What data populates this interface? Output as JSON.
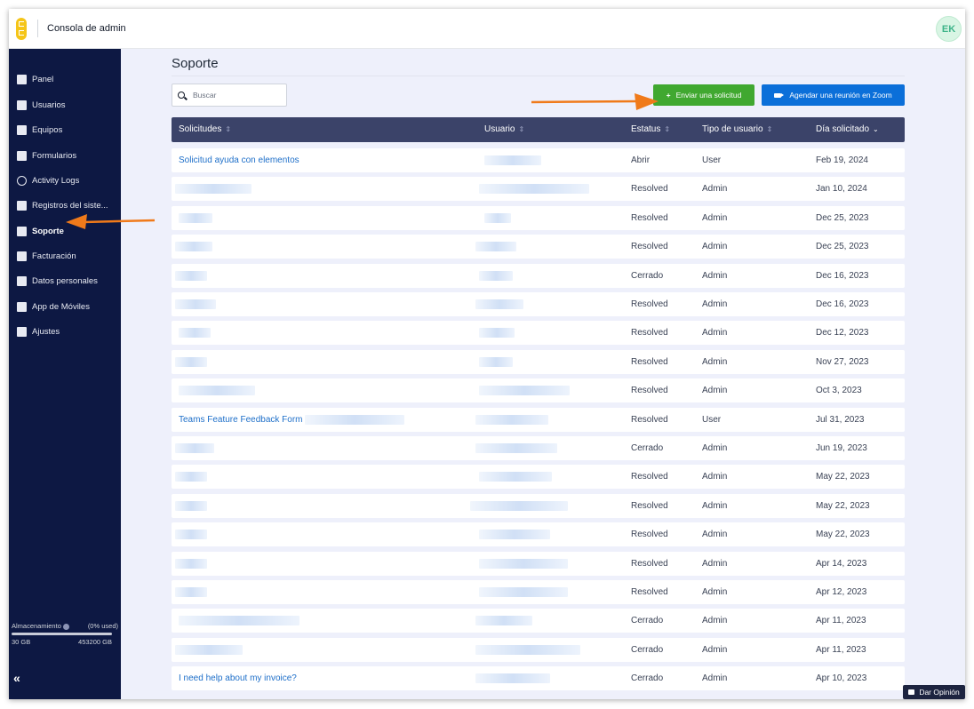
{
  "app": {
    "title": "Consola de admin",
    "avatar_initials": "EK"
  },
  "sidebar": {
    "items": [
      {
        "label": "Panel",
        "icon": "home-icon"
      },
      {
        "label": "Usuarios",
        "icon": "users-icon"
      },
      {
        "label": "Equipos",
        "icon": "teams-icon"
      },
      {
        "label": "Formularios",
        "icon": "forms-icon"
      },
      {
        "label": "Activity Logs",
        "icon": "clock-icon"
      },
      {
        "label": "Registros del siste...",
        "icon": "database-icon"
      },
      {
        "label": "Soporte",
        "icon": "support-icon"
      },
      {
        "label": "Facturación",
        "icon": "credit-card-icon"
      },
      {
        "label": "Datos personales",
        "icon": "personal-data-icon"
      },
      {
        "label": "App de Móviles",
        "icon": "mobile-icon"
      },
      {
        "label": "Ajustes",
        "icon": "gear-icon"
      }
    ],
    "active": "Soporte",
    "storage": {
      "label": "Almacenamiento",
      "used_text": "(0% used)",
      "used": "30 GB",
      "total": "453200 GB",
      "used_fraction": 0.0
    },
    "collapse_label": "«"
  },
  "main": {
    "title": "Soporte",
    "search": {
      "placeholder": "Buscar",
      "value": ""
    },
    "buttons": {
      "submit": "Enviar una solicitud",
      "zoom": "Agendar una reunión en Zoom"
    },
    "table": {
      "headers": [
        "Solicitudes",
        "Usuario",
        "Estatus",
        "Tipo de usuario",
        "Día solicitado"
      ],
      "rows": [
        {
          "request": "Solicitud ayuda con elementos",
          "status": "Abrir",
          "type": "User",
          "date": "Feb 19, 2024"
        },
        {
          "request": "",
          "status": "Resolved",
          "type": "Admin",
          "date": "Jan 10, 2024"
        },
        {
          "request": "",
          "status": "Resolved",
          "type": "Admin",
          "date": "Dec 25, 2023"
        },
        {
          "request": "",
          "status": "Resolved",
          "type": "Admin",
          "date": "Dec 25, 2023"
        },
        {
          "request": "",
          "status": "Cerrado",
          "type": "Admin",
          "date": "Dec 16, 2023"
        },
        {
          "request": "",
          "status": "Resolved",
          "type": "Admin",
          "date": "Dec 16, 2023"
        },
        {
          "request": "",
          "status": "Resolved",
          "type": "Admin",
          "date": "Dec 12, 2023"
        },
        {
          "request": "",
          "status": "Resolved",
          "type": "Admin",
          "date": "Nov 27, 2023"
        },
        {
          "request": "",
          "status": "Resolved",
          "type": "Admin",
          "date": "Oct 3, 2023"
        },
        {
          "request": "Teams Feature Feedback Form",
          "status": "Resolved",
          "type": "User",
          "date": "Jul 31, 2023"
        },
        {
          "request": "",
          "status": "Cerrado",
          "type": "Admin",
          "date": "Jun 19, 2023"
        },
        {
          "request": "",
          "status": "Resolved",
          "type": "Admin",
          "date": "May 22, 2023"
        },
        {
          "request": "",
          "status": "Resolved",
          "type": "Admin",
          "date": "May 22, 2023"
        },
        {
          "request": "",
          "status": "Resolved",
          "type": "Admin",
          "date": "May 22, 2023"
        },
        {
          "request": "",
          "status": "Resolved",
          "type": "Admin",
          "date": "Apr 14, 2023"
        },
        {
          "request": "",
          "status": "Resolved",
          "type": "Admin",
          "date": "Apr 12, 2023"
        },
        {
          "request": "",
          "status": "Cerrado",
          "type": "Admin",
          "date": "Apr 11, 2023"
        },
        {
          "request": "",
          "status": "Cerrado",
          "type": "Admin",
          "date": "Apr 11, 2023"
        },
        {
          "request": "I need help about my invoice?",
          "status": "Cerrado",
          "type": "Admin",
          "date": "Apr 10, 2023"
        }
      ]
    }
  },
  "feedback_button": "Dar Opinión",
  "colors": {
    "sidebar": "#0d1843",
    "header_row": "#3b4369",
    "primary_green": "#40a830",
    "zoom_blue": "#0b6fd9",
    "link": "#1e6fc9",
    "annotation_arrow": "#f07a1a"
  }
}
